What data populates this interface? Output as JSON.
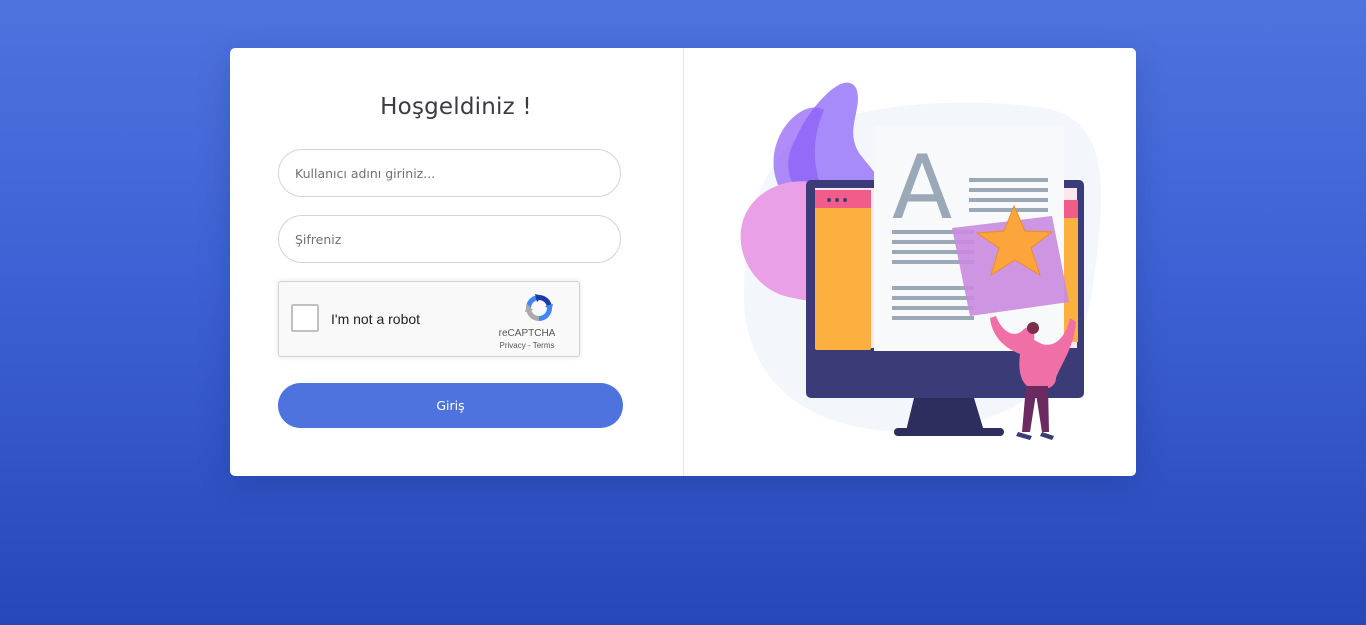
{
  "login": {
    "title": "Hoşgeldiniz !",
    "username_placeholder": "Kullanıcı adını giriniz...",
    "username_value": "",
    "password_placeholder": "Şifreniz",
    "password_value": "",
    "submit_label": "Giriş"
  },
  "recaptcha": {
    "label": "I'm not a robot",
    "checked": false,
    "brand": "reCAPTCHA",
    "privacy": "Privacy",
    "separator": " - ",
    "terms": "Terms"
  },
  "illustration": {
    "letter": "A",
    "icons": [
      "star-icon"
    ]
  },
  "colors": {
    "background_top": "#4e73df",
    "background_bottom": "#2647b8",
    "accent": "#4e73df",
    "card": "#ffffff"
  }
}
